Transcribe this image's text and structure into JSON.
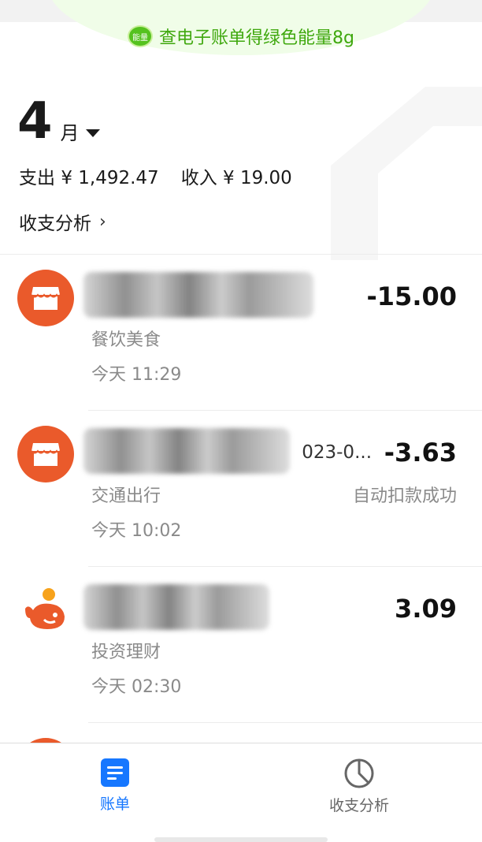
{
  "banner": {
    "badge": "能量",
    "text": "查电子账单得绿色能量8g"
  },
  "header": {
    "month": "4",
    "month_unit": "月",
    "expense_label": "支出",
    "expense_value": "¥ 1,492.47",
    "income_label": "收入",
    "income_value": "¥ 19.00",
    "analysis_link": "收支分析"
  },
  "transactions": [
    {
      "icon": "store-icon",
      "merchant_tail": "",
      "amount": "-15.00",
      "category": "餐饮美食",
      "status": "",
      "time": "今天  11:29"
    },
    {
      "icon": "store-icon",
      "merchant_tail": "023-0...",
      "amount": "-3.63",
      "category": "交通出行",
      "status": "自动扣款成功",
      "time": "今天  10:02"
    },
    {
      "icon": "whale-icon",
      "merchant_tail": "",
      "amount": "3.09",
      "category": "投资理财",
      "status": "",
      "time": "今天  02:30"
    }
  ],
  "tabbar": {
    "tabs": [
      {
        "label": "账单",
        "icon": "bill-icon",
        "active": true
      },
      {
        "label": "收支分析",
        "icon": "pie-chart-icon",
        "active": false
      }
    ]
  },
  "colors": {
    "accent": "#1677ff",
    "brand_orange": "#ea5a2b",
    "energy_green": "#3fa80e"
  }
}
